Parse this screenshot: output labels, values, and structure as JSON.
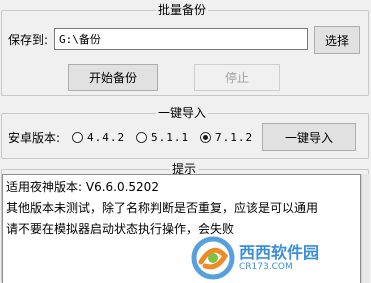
{
  "batch_backup": {
    "title": "批量备份",
    "save_to_label": "保存到:",
    "path_value": "G:\\备份",
    "choose_button": "选择",
    "start_button": "开始备份",
    "stop_button": "停止"
  },
  "one_click_import": {
    "title": "一键导入",
    "android_version_label": "安卓版本:",
    "versions": [
      {
        "label": "4.4.2",
        "selected": false
      },
      {
        "label": "5.1.1",
        "selected": false
      },
      {
        "label": "7.1.2",
        "selected": true
      }
    ],
    "import_button": "一键导入"
  },
  "tips": {
    "title": "提示",
    "lines": [
      "适用夜神版本: V6.6.0.5202",
      "其他版本未测试，除了名称判断是否重复，应该是可以通用",
      "请不要在模拟器启动状态执行操作，会失败"
    ]
  },
  "watermark": {
    "brand": "西西软件园",
    "url": "CR173.COM",
    "accent_color": "#3a8fd8"
  }
}
